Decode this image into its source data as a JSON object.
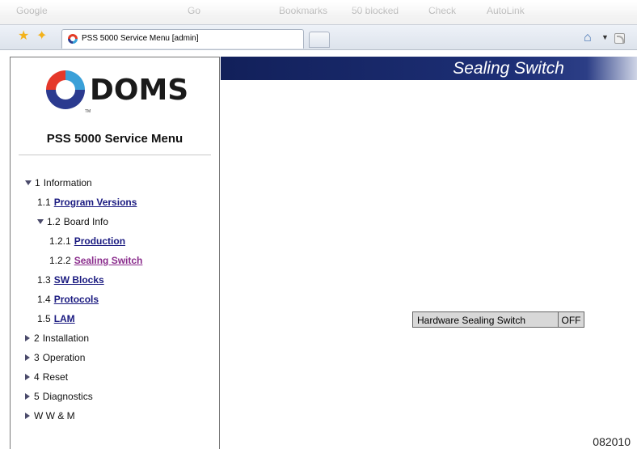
{
  "browser": {
    "toolbar_items": [
      "Google",
      "Go",
      "Bookmarks",
      "50 blocked",
      "Check",
      "AutoLink"
    ],
    "tab_title": "PSS 5000 Service Menu [admin]"
  },
  "sidebar": {
    "logo_text": "DOMS",
    "logo_tm": "TM",
    "menu_title": "PSS 5000 Service Menu",
    "items": [
      {
        "num": "1",
        "label": "Information",
        "expanded": true
      },
      {
        "num": "1.1",
        "label": "Program Versions",
        "link": true
      },
      {
        "num": "1.2",
        "label": "Board Info",
        "expanded": true
      },
      {
        "num": "1.2.1",
        "label": "Production",
        "link": true
      },
      {
        "num": "1.2.2",
        "label": "Sealing Switch",
        "link": true,
        "active": true
      },
      {
        "num": "1.3",
        "label": "SW Blocks",
        "link": true
      },
      {
        "num": "1.4",
        "label": "Protocols",
        "link": true
      },
      {
        "num": "1.5",
        "label": "LAM",
        "link": true
      },
      {
        "num": "2",
        "label": "Installation",
        "expanded": false
      },
      {
        "num": "3",
        "label": "Operation",
        "expanded": false
      },
      {
        "num": "4",
        "label": "Reset",
        "expanded": false
      },
      {
        "num": "5",
        "label": "Diagnostics",
        "expanded": false
      },
      {
        "num": "",
        "label": "W W & M",
        "expanded": false
      }
    ]
  },
  "main": {
    "title": "Sealing Switch",
    "status_label": "Hardware Sealing Switch",
    "status_value": "OFF"
  },
  "figure_id": "082010",
  "colors": {
    "header_bar": "#12205a",
    "link": "#1a1a80",
    "active_link": "#8a2c8c"
  }
}
